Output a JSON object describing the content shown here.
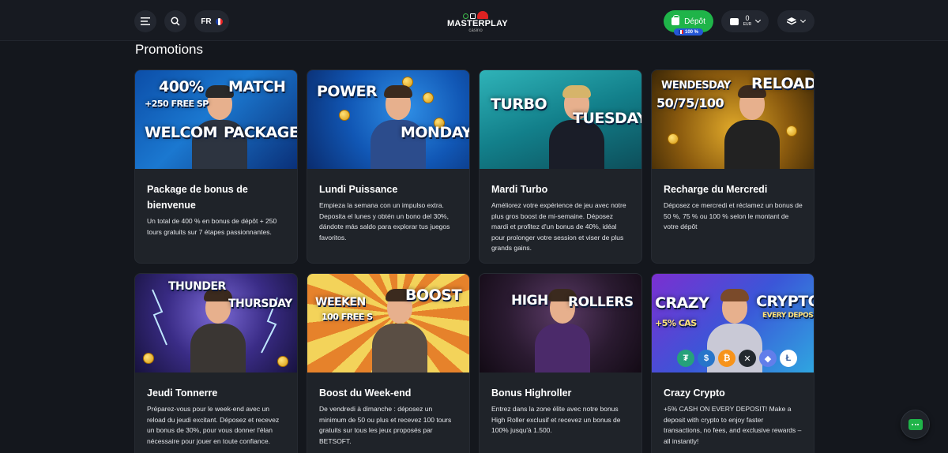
{
  "header": {
    "language": "FR",
    "logo_text": "MASTERPLAY",
    "logo_sub": "casino",
    "deposit_label": "Dépôt",
    "bonus_tag": "100 %",
    "balance_amount": "0",
    "balance_currency": "EUR"
  },
  "page": {
    "title": "Promotions"
  },
  "colors": {
    "accent_green": "#1fb449",
    "bonus_blue": "#2557d6",
    "background": "#14171d",
    "card": "#1f2329"
  },
  "cards": [
    {
      "title": "Package de bonus de bienvenue",
      "desc": "Un total de 400 % en bonus de dépôt + 250 tours gratuits sur 7 étapes passionnantes.",
      "banner1": "400%",
      "banner2": "MATCH",
      "banner3": "+250 FREE SP",
      "banner4": "WELCOM",
      "banner5": "PACKAGE"
    },
    {
      "title": "Lundi Puissance",
      "desc": "Empieza la semana con un impulso extra. Deposita el lunes y obtén un bono del 30%, dándote más saldo para explorar tus juegos favoritos.",
      "banner1": "POWER",
      "banner2": "MONDAY"
    },
    {
      "title": "Mardi Turbo",
      "desc": "Améliorez votre expérience de jeu avec notre plus gros boost de mi-semaine. Déposez mardi et profitez d'un bonus de 40%, idéal pour prolonger votre session et viser de plus grands gains.",
      "banner1": "TURBO",
      "banner2": "TUESDAY"
    },
    {
      "title": "Recharge du Mercredi",
      "desc": "Déposez ce mercredi et réclamez un bonus de 50 %, 75 % ou 100 % selon le montant de votre dépôt",
      "banner1": "WENDESDAY",
      "banner2": "RELOAD",
      "banner3": "50/75/100"
    },
    {
      "title": "Jeudi Tonnerre",
      "desc": "Préparez-vous pour le week-end avec un reload du jeudi excitant. Déposez et recevez un bonus de 30%, pour vous donner l'élan nécessaire pour jouer en toute confiance.",
      "banner1": "THUNDER",
      "banner2": "THURSDAY"
    },
    {
      "title": "Boost du Week-end",
      "desc": "De vendredi à dimanche : déposez un minimum de 50 ou plus et recevez 100 tours gratuits sur tous les jeux proposés par BETSOFT.",
      "banner1": "WEEKEN",
      "banner2": "BOOST",
      "banner3": "100 FREE S"
    },
    {
      "title": "Bonus Highroller",
      "desc": "Entrez dans la zone élite avec notre bonus High Roller exclusif et recevez un bonus de 100% jusqu'à 1.500.",
      "banner1": "HIGH",
      "banner2": "ROLLERS"
    },
    {
      "title": "Crazy Crypto",
      "desc": "+5% CASH ON EVERY DEPOSIT! Make a deposit with crypto to enjoy faster transactions, no fees, and exclusive rewards – all instantly!",
      "banner1": "CRAZY",
      "banner2": "CRYPTO",
      "banner3": "+5% CAS",
      "banner4": "EVERY DEPOS"
    }
  ]
}
